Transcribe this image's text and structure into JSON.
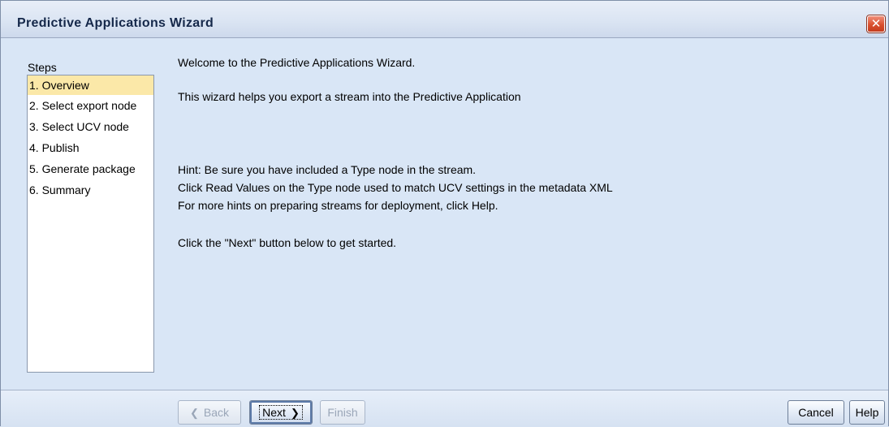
{
  "window": {
    "title": "Predictive Applications Wizard",
    "close_glyph": "✕"
  },
  "steps": {
    "label": "Steps",
    "items": [
      {
        "label": "1. Overview",
        "selected": true
      },
      {
        "label": "2. Select export node"
      },
      {
        "label": "3. Select UCV node"
      },
      {
        "label": "4. Publish"
      },
      {
        "label": "5. Generate package"
      },
      {
        "label": "6. Summary"
      }
    ]
  },
  "main": {
    "welcome": "Welcome to the Predictive Applications Wizard.",
    "intro": "This wizard helps you export a stream into the Predictive Application",
    "hint1": "Hint: Be sure you have included a Type node in the stream.",
    "hint2": "Click Read Values on the Type node used to match UCV settings in the metadata XML",
    "hint3": "For more hints on preparing streams for deployment, click Help.",
    "start": "Click the \"Next\" button below to get started."
  },
  "buttons": {
    "back": "Back",
    "next": "Next",
    "finish": "Finish",
    "cancel": "Cancel",
    "help": "Help"
  }
}
